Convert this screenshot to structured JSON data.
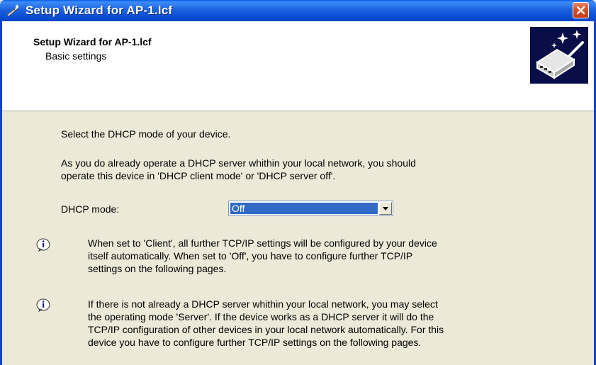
{
  "window": {
    "title": "Setup Wizard for AP-1.lcf",
    "close_icon": "close-icon"
  },
  "header": {
    "title": "Setup Wizard for AP-1.lcf",
    "subtitle": "Basic settings",
    "icon": "wizard-device-icon"
  },
  "content": {
    "intro": "Select the DHCP mode of your device.",
    "advice_line1": "As you do already operate a DHCP server whithin your local network, you should",
    "advice_line2": "operate this device in 'DHCP client mode' or 'DHCP server off'.",
    "dhcp_label": "DHCP mode:",
    "dhcp_value": "Off",
    "info1": [
      "When set to 'Client', all further TCP/IP settings will be configured by your device",
      "itself automatically. When set to 'Off', you have to configure further TCP/IP",
      "settings on the following pages."
    ],
    "info2": [
      "If there is not already a DHCP server whithin your local network, you may select",
      "the operating mode 'Server'. If the device works as a DHCP server it will do the",
      "TCP/IP configuration of other devices in your local network automatically. For this",
      "device you have to configure further TCP/IP settings on the following pages."
    ]
  },
  "colors": {
    "titlebar": "#0D4FD6",
    "background": "#ECE9D8",
    "selection": "#316AC5"
  }
}
